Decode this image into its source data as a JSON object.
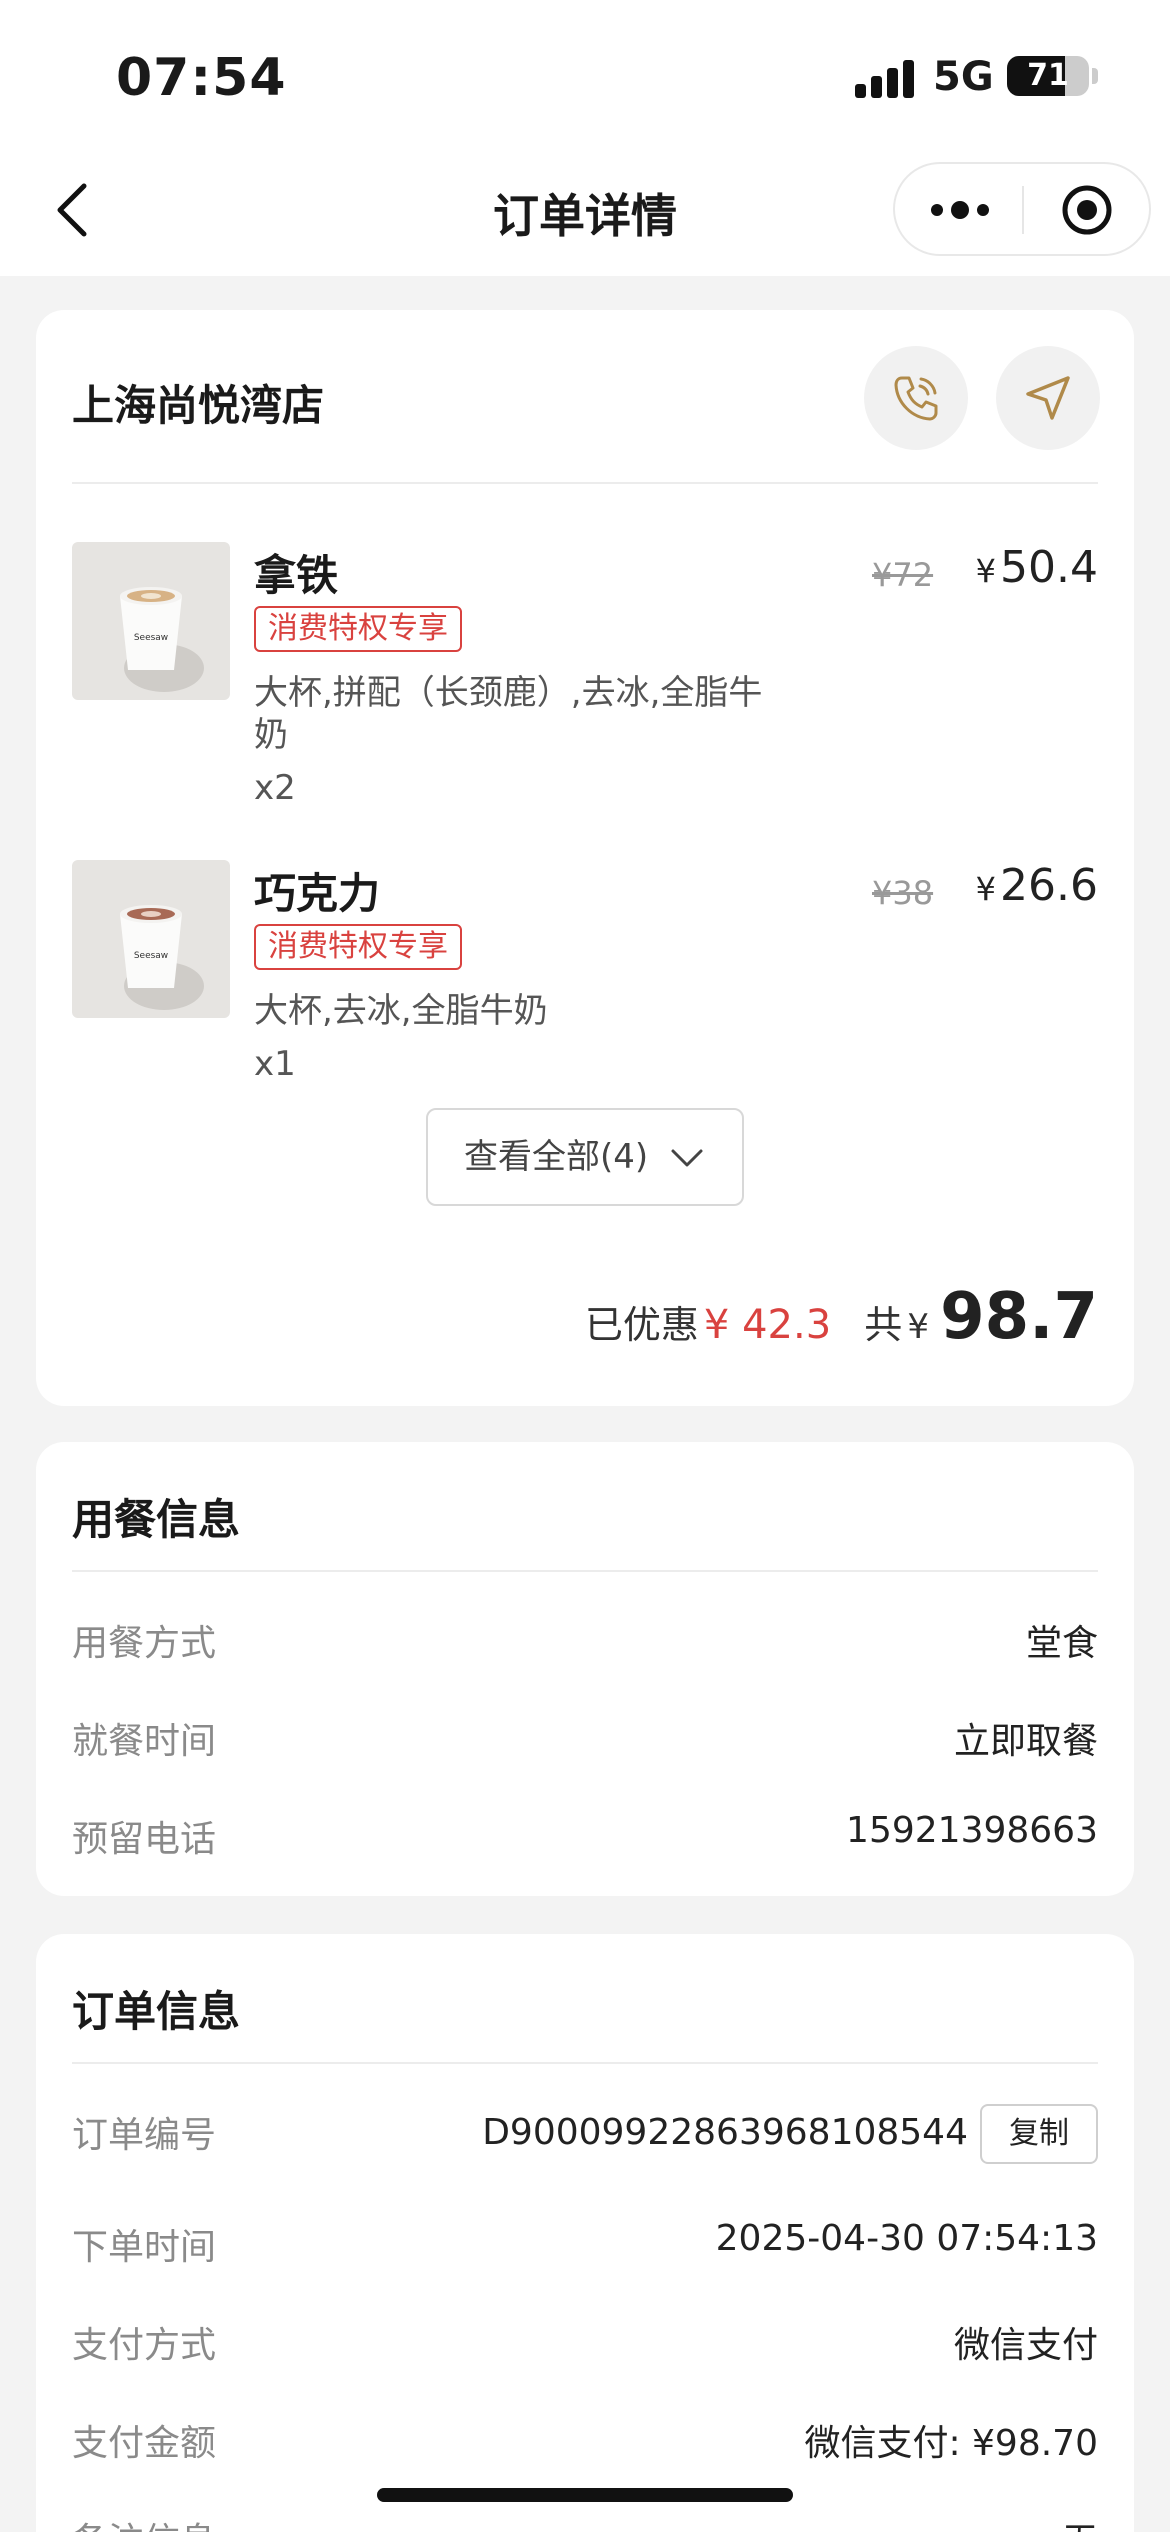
{
  "status_bar": {
    "time": "07:54",
    "network": "5G",
    "battery_percent": "71",
    "battery_level": 0.71
  },
  "nav": {
    "title": "订单详情",
    "back_icon": "chevron-left-icon",
    "more_icon": "more-dots-icon",
    "close_icon": "target-icon"
  },
  "store": {
    "name": "上海尚悦湾店",
    "phone_icon": "phone-icon",
    "navigate_icon": "navigation-arrow-icon",
    "accent_color": "#b08a4a"
  },
  "items": [
    {
      "name": "拿铁",
      "tag": "消费特权专享",
      "spec": "大杯,拼配（长颈鹿）,去冰,全脂牛奶",
      "qty": "x2",
      "original_price": "¥72",
      "price_symbol": "¥",
      "price": "50.4"
    },
    {
      "name": "巧克力",
      "tag": "消费特权专享",
      "spec": "大杯,去冰,全脂牛奶",
      "qty": "x1",
      "original_price": "¥38",
      "price_symbol": "¥",
      "price": "26.6"
    }
  ],
  "view_all": {
    "label": "查看全部(4)"
  },
  "summary": {
    "discount_label": "已优惠",
    "discount_value": "¥ 42.3",
    "total_label": "共",
    "total_symbol": "¥",
    "total_value": "98.7"
  },
  "dining": {
    "title": "用餐信息",
    "rows": [
      {
        "label": "用餐方式",
        "value": "堂食"
      },
      {
        "label": "就餐时间",
        "value": "立即取餐"
      },
      {
        "label": "预留电话",
        "value": "15921398663"
      }
    ]
  },
  "order": {
    "title": "订单信息",
    "rows": [
      {
        "label": "订单编号",
        "value": "D900099228639681085​44"
      },
      {
        "label": "下单时间",
        "value": "2025-04-30 07:54:13"
      },
      {
        "label": "支付方式",
        "value": "微信支付"
      },
      {
        "label": "支付金额",
        "value": "微信支付: ¥98.70"
      },
      {
        "label": "备注信息",
        "value": "无"
      }
    ],
    "copy_label": "复制"
  },
  "colors": {
    "discount_red": "#d9423f",
    "tag_red": "#d9423f",
    "background": "#f3f3f3"
  }
}
